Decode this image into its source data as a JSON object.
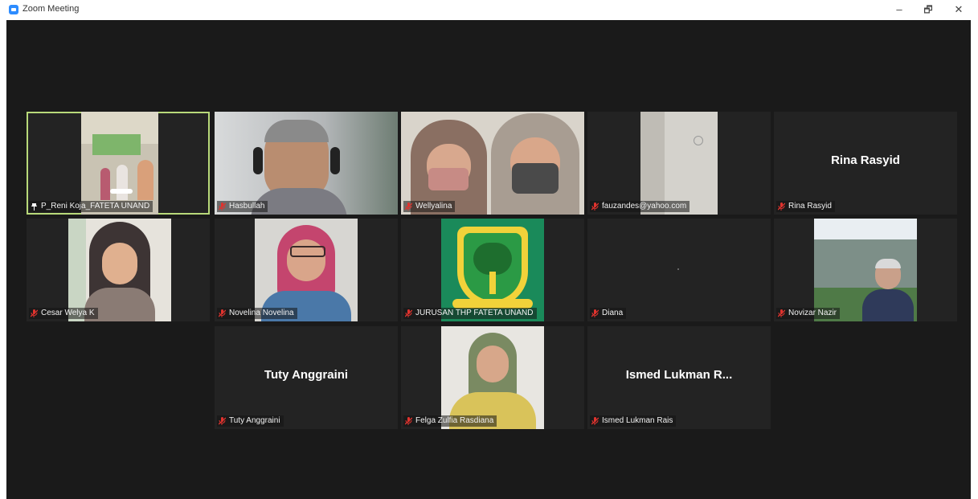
{
  "window": {
    "title": "Zoom Meeting",
    "minimize": "–",
    "restore": "🗗",
    "close": "✕"
  },
  "colors": {
    "stage": "#1a1a1a",
    "tile": "#232323",
    "active_border": "#b8d97a",
    "muted_mic": "#e0332e"
  },
  "participants": [
    {
      "name": "P_Reni Koja_FATETA UNAND",
      "muted": false,
      "video": true,
      "active": true
    },
    {
      "name": "Hasbullah",
      "muted": true,
      "video": true
    },
    {
      "name": "Wellyalina",
      "muted": true,
      "video": true
    },
    {
      "name": "fauzandes@yahoo.com",
      "muted": true,
      "video": true
    },
    {
      "name": "Rina Rasyid",
      "display_name": "Rina Rasyid",
      "muted": true,
      "video": false
    },
    {
      "name": "Cesar Welya K",
      "muted": true,
      "video": true
    },
    {
      "name": "Novelina Novelina",
      "muted": true,
      "video": true
    },
    {
      "name": "JURUSAN THP FATETA UNAND",
      "muted": true,
      "video": true
    },
    {
      "name": "Diana",
      "muted": true,
      "video": true
    },
    {
      "name": "Novizar Nazir",
      "muted": true,
      "video": true
    },
    {
      "name": "Tuty Anggraini",
      "display_name": "Tuty Anggraini",
      "muted": true,
      "video": false
    },
    {
      "name": "Felga Zulfia Rasdiana",
      "muted": true,
      "video": true
    },
    {
      "name": "Ismed Lukman Rais",
      "display_name": "Ismed Lukman R...",
      "muted": true,
      "video": false
    }
  ]
}
